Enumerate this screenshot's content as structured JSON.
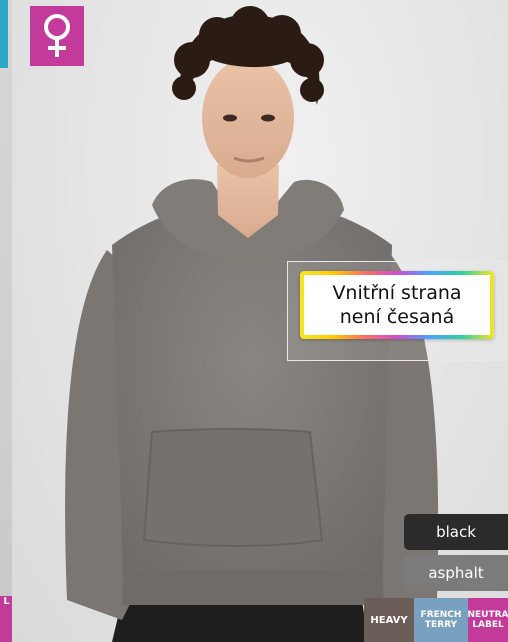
{
  "callout": {
    "line1": "Vnitřní strana",
    "line2": "není česaná"
  },
  "colors": [
    {
      "label": "black",
      "hex": "#2b2b2b"
    },
    {
      "label": "asphalt",
      "hex": "#7b7b7b"
    }
  ],
  "tags": {
    "heavy": "HEAVY",
    "french_terry_line1": "FRENCH",
    "french_terry_line2": "TERRY",
    "neutral_line1": "NEUTRA",
    "neutral_line2": "LABEL",
    "left_edge_tag": "L"
  },
  "badge": {
    "icon": "female-symbol-icon",
    "color": "#c23b9b"
  },
  "accent": {
    "magenta": "#c23b9b",
    "cyan": "#2aa7c9"
  }
}
